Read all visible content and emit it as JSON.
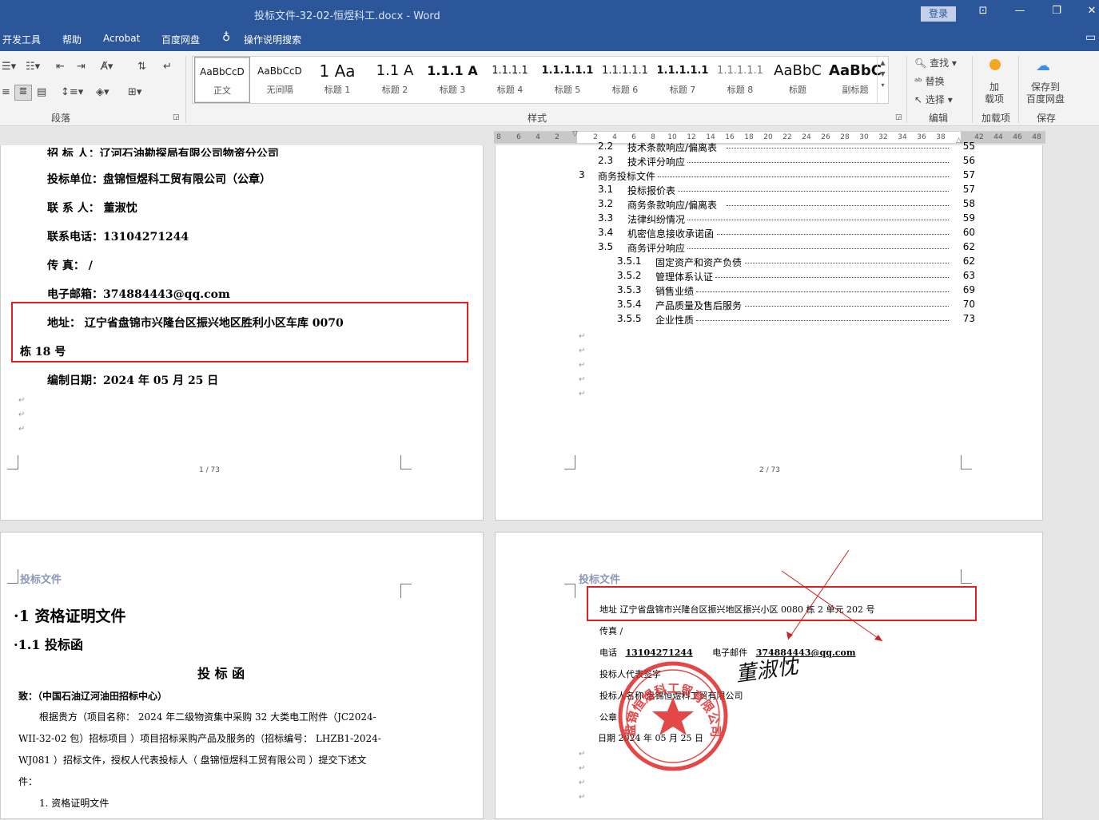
{
  "window": {
    "title": "投标文件-32-02-恒煜科工.docx  -  Word",
    "login": "登录",
    "btn_ribbon": "⊡",
    "btn_min": "—",
    "btn_max": "❐",
    "btn_close": "✕"
  },
  "menu": {
    "items": [
      "开发工具",
      "帮助",
      "Acrobat",
      "百度网盘"
    ],
    "tell_me": "操作说明搜索",
    "tell_me_icon": "lightbulb-icon"
  },
  "ribbon": {
    "paragraph_label": "段落",
    "styles_label": "样式",
    "editing_label": "编辑",
    "addin_label": "加载项",
    "save_label": "保存",
    "styles": [
      {
        "preview": "AaBbCcD",
        "name": "正文"
      },
      {
        "preview": "AaBbCcD",
        "name": "无间隔"
      },
      {
        "preview": "1  Aa",
        "name": "标题 1"
      },
      {
        "preview": "1.1  A",
        "name": "标题 2"
      },
      {
        "preview": "1.1.1  A",
        "name": "标题 3"
      },
      {
        "preview": "1.1.1.1",
        "name": "标题 4"
      },
      {
        "preview": "1.1.1.1.1",
        "name": "标题 5"
      },
      {
        "preview": "1.1.1.1.1",
        "name": "标题 6"
      },
      {
        "preview": "1.1.1.1.1",
        "name": "标题 7"
      },
      {
        "preview": "1.1.1.1.1",
        "name": "标题 8"
      },
      {
        "preview": "AaBbC",
        "name": "标题"
      },
      {
        "preview": "AaBbC",
        "name": "副标题"
      }
    ],
    "find": "查找",
    "replace": "替换",
    "select": "选择",
    "addin": "加\n载项",
    "save_baidu": "保存到\n百度网盘"
  },
  "ruler": {
    "left": [
      "8",
      "6",
      "4",
      "2"
    ],
    "right": [
      "2",
      "4",
      "6",
      "8",
      "10",
      "12",
      "14",
      "16",
      "18",
      "20",
      "22",
      "24",
      "26",
      "28",
      "30",
      "32",
      "34",
      "36",
      "38",
      "42",
      "44",
      "46",
      "48"
    ]
  },
  "page1": {
    "line0": "招 标 人：辽河石油勘探局有限公司物资分公司",
    "bidder": "投标单位：盘锦恒煜科工贸有限公司（公章）",
    "contact": "联 系 人：  董淑忱",
    "phone": "联系电话：13104271244",
    "fax": "传      真：  /",
    "email": "电子邮箱：374884443@qq.com",
    "address1": "地址：  辽宁省盘锦市兴隆台区振兴地区胜利小区车库 0070",
    "address2": "栋 18 号",
    "date": "编制日期：2024 年 05 月 25 日",
    "footer": "1 / 73"
  },
  "page2": {
    "toc": [
      {
        "lvl": 2,
        "num": "2.2",
        "text": "技术条款响应/偏离表",
        "page": "55"
      },
      {
        "lvl": 2,
        "num": "2.3",
        "text": "技术评分响应",
        "page": "56"
      },
      {
        "lvl": 1,
        "num": "3",
        "text": "商务投标文件",
        "page": "57"
      },
      {
        "lvl": 2,
        "num": "3.1",
        "text": "投标报价表",
        "page": "57"
      },
      {
        "lvl": 2,
        "num": "3.2",
        "text": "商务条款响应/偏离表",
        "page": "58"
      },
      {
        "lvl": 2,
        "num": "3.3",
        "text": "法律纠纷情况",
        "page": "59"
      },
      {
        "lvl": 2,
        "num": "3.4",
        "text": "机密信息接收承诺函",
        "page": "60"
      },
      {
        "lvl": 2,
        "num": "3.5",
        "text": "商务评分响应",
        "page": "62"
      },
      {
        "lvl": 3,
        "num": "3.5.1",
        "text": "固定资产和资产负债",
        "page": "62"
      },
      {
        "lvl": 3,
        "num": "3.5.2",
        "text": "管理体系认证",
        "page": "63"
      },
      {
        "lvl": 3,
        "num": "3.5.3",
        "text": "销售业绩",
        "page": "69"
      },
      {
        "lvl": 3,
        "num": "3.5.4",
        "text": "产品质量及售后服务",
        "page": "70"
      },
      {
        "lvl": 3,
        "num": "3.5.5",
        "text": "企业性质",
        "page": "73"
      }
    ],
    "footer": "2 / 73"
  },
  "page3": {
    "header": "投标文件",
    "h1": "·1  资格证明文件",
    "h2": "·1.1 投标函",
    "title": "投 标 函",
    "to": "致：（中国石油辽河油田招标中心）",
    "body1": "根据贵方（项目名称：   2024 年二级物资集中采购 32 大类电工附件（JC2024-",
    "body2": "WII-32-02 包）招标项目   ）项目招标采购产品及服务的（招标编号：   LHZB1-2024-",
    "body3": "WJ081   ）招标文件，授权人代表投标人（  盘锦恒煜科工贸有限公司  ）提交下述文",
    "body4": "件：",
    "item1": "1.   资格证明文件"
  },
  "page4": {
    "header": "投标文件",
    "address": "地址  辽宁省盘锦市兴隆台区振兴地区振兴小区 0080 栋 2 单元 202 号",
    "fax": "传真      /",
    "phone_label": "电话",
    "phone": "13104271244",
    "email_label": "电子邮件",
    "email": "374884443@qq.com",
    "rep": "投标人代表签字",
    "signature": "董淑忱",
    "name": "投标人名称   盘锦恒煜科工贸有限公司",
    "seal_label": "公章",
    "date": "日期  2024 年 05 月 25 日",
    "stamp_text": "盘锦恒煜科工贸有限公司"
  },
  "colors": {
    "accent": "#2b579a",
    "red": "#e02020",
    "stamp": "#e02828"
  }
}
